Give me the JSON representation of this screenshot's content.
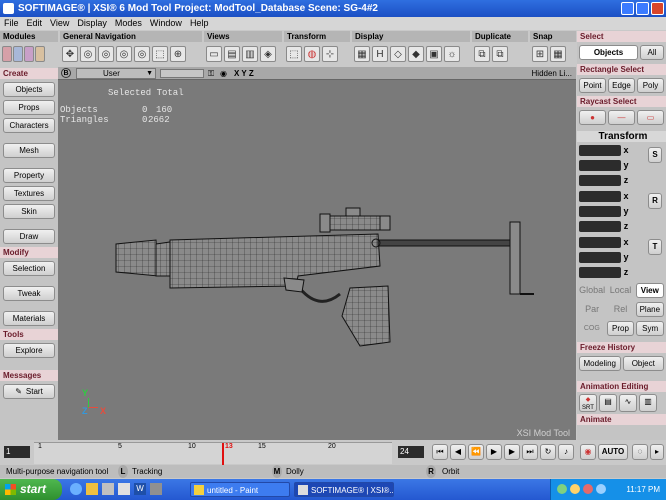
{
  "window": {
    "title": "SOFTIMAGE® | XSI® 6 Mod Tool Project: ModTool_Database    Scene: SG-4#2"
  },
  "menus": [
    "File",
    "Edit",
    "View",
    "Display",
    "Modes",
    "Window",
    "Help"
  ],
  "toolbar": {
    "sections": [
      "Modules",
      "General Navigation",
      "Views",
      "Transform",
      "Display",
      "Duplicate",
      "Snap"
    ]
  },
  "left": {
    "header_create": "Create",
    "create_items": [
      "Objects",
      "Props",
      "Characters",
      "Mesh",
      "Property",
      "Textures",
      "Skin",
      "Draw"
    ],
    "header_modify": "Modify",
    "modify_items": [
      "Selection",
      "Tweak",
      "Materials"
    ],
    "header_tools": "Tools",
    "tools_items": [
      "Explore"
    ],
    "header_messages": "Messages",
    "start": "Start"
  },
  "viewport": {
    "camera": "User",
    "letter": "B",
    "axes": "X Y Z",
    "mode": "Hidden Li...",
    "stats_header": "Selected Total",
    "stats": [
      {
        "label": "Objects",
        "selected": "0",
        "total": "160"
      },
      {
        "label": "Triangles",
        "selected": "0",
        "total": "2662"
      }
    ],
    "watermark": "XSI Mod Tool",
    "axis_y": "Y",
    "axis_x": "X",
    "axis_z": "Z"
  },
  "right": {
    "select_header": "Select",
    "objects": "Objects",
    "all": "All",
    "rect_header": "Rectangle Select",
    "point": "Point",
    "edge": "Edge",
    "poly": "Poly",
    "raycast_header": "Raycast Select",
    "transform_header": "Transform",
    "axes": [
      "x",
      "y",
      "z"
    ],
    "side_btns": [
      "S",
      "R",
      "T"
    ],
    "global": "Global",
    "local": "Local",
    "view": "View",
    "par": "Par",
    "rel": "Rel",
    "plane": "Plane",
    "cog": "COG",
    "prop": "Prop",
    "sym": "Sym",
    "freeze_header": "Freeze History",
    "modeling": "Modeling",
    "object": "Object",
    "anim_header": "Animation Editing",
    "animate_header": "Animate",
    "srt": "SRT",
    "auto": "AUTO"
  },
  "timeline": {
    "start": "1",
    "current": "13",
    "end": "24",
    "ticks": [
      "1",
      "5",
      "10",
      "15",
      "20"
    ]
  },
  "status": {
    "tool": "Multi-purpose navigation tool",
    "l_key": "L",
    "l": "Tracking",
    "m_key": "M",
    "m": "Dolly",
    "r_key": "R",
    "r": "Orbit"
  },
  "taskbar": {
    "start": "start",
    "tasks": [
      "untitled - Paint",
      "SOFTIMAGE® | XSI®..."
    ],
    "clock": "11:17 PM"
  }
}
